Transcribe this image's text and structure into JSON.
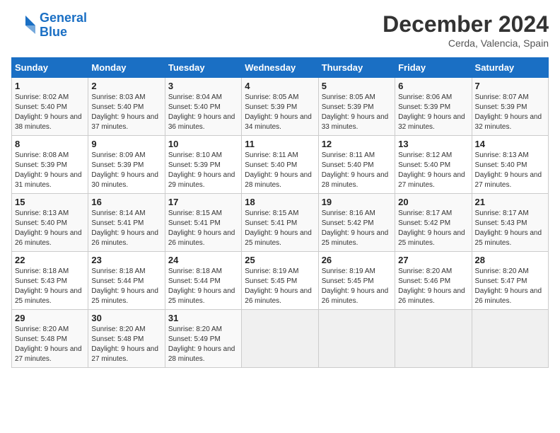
{
  "header": {
    "logo_line1": "General",
    "logo_line2": "Blue",
    "month": "December 2024",
    "location": "Cerda, Valencia, Spain"
  },
  "weekdays": [
    "Sunday",
    "Monday",
    "Tuesday",
    "Wednesday",
    "Thursday",
    "Friday",
    "Saturday"
  ],
  "weeks": [
    [
      {
        "day": "1",
        "info": "Sunrise: 8:02 AM\nSunset: 5:40 PM\nDaylight: 9 hours and 38 minutes."
      },
      {
        "day": "2",
        "info": "Sunrise: 8:03 AM\nSunset: 5:40 PM\nDaylight: 9 hours and 37 minutes."
      },
      {
        "day": "3",
        "info": "Sunrise: 8:04 AM\nSunset: 5:40 PM\nDaylight: 9 hours and 36 minutes."
      },
      {
        "day": "4",
        "info": "Sunrise: 8:05 AM\nSunset: 5:39 PM\nDaylight: 9 hours and 34 minutes."
      },
      {
        "day": "5",
        "info": "Sunrise: 8:05 AM\nSunset: 5:39 PM\nDaylight: 9 hours and 33 minutes."
      },
      {
        "day": "6",
        "info": "Sunrise: 8:06 AM\nSunset: 5:39 PM\nDaylight: 9 hours and 32 minutes."
      },
      {
        "day": "7",
        "info": "Sunrise: 8:07 AM\nSunset: 5:39 PM\nDaylight: 9 hours and 32 minutes."
      }
    ],
    [
      {
        "day": "8",
        "info": "Sunrise: 8:08 AM\nSunset: 5:39 PM\nDaylight: 9 hours and 31 minutes."
      },
      {
        "day": "9",
        "info": "Sunrise: 8:09 AM\nSunset: 5:39 PM\nDaylight: 9 hours and 30 minutes."
      },
      {
        "day": "10",
        "info": "Sunrise: 8:10 AM\nSunset: 5:39 PM\nDaylight: 9 hours and 29 minutes."
      },
      {
        "day": "11",
        "info": "Sunrise: 8:11 AM\nSunset: 5:40 PM\nDaylight: 9 hours and 28 minutes."
      },
      {
        "day": "12",
        "info": "Sunrise: 8:11 AM\nSunset: 5:40 PM\nDaylight: 9 hours and 28 minutes."
      },
      {
        "day": "13",
        "info": "Sunrise: 8:12 AM\nSunset: 5:40 PM\nDaylight: 9 hours and 27 minutes."
      },
      {
        "day": "14",
        "info": "Sunrise: 8:13 AM\nSunset: 5:40 PM\nDaylight: 9 hours and 27 minutes."
      }
    ],
    [
      {
        "day": "15",
        "info": "Sunrise: 8:13 AM\nSunset: 5:40 PM\nDaylight: 9 hours and 26 minutes."
      },
      {
        "day": "16",
        "info": "Sunrise: 8:14 AM\nSunset: 5:41 PM\nDaylight: 9 hours and 26 minutes."
      },
      {
        "day": "17",
        "info": "Sunrise: 8:15 AM\nSunset: 5:41 PM\nDaylight: 9 hours and 26 minutes."
      },
      {
        "day": "18",
        "info": "Sunrise: 8:15 AM\nSunset: 5:41 PM\nDaylight: 9 hours and 25 minutes."
      },
      {
        "day": "19",
        "info": "Sunrise: 8:16 AM\nSunset: 5:42 PM\nDaylight: 9 hours and 25 minutes."
      },
      {
        "day": "20",
        "info": "Sunrise: 8:17 AM\nSunset: 5:42 PM\nDaylight: 9 hours and 25 minutes."
      },
      {
        "day": "21",
        "info": "Sunrise: 8:17 AM\nSunset: 5:43 PM\nDaylight: 9 hours and 25 minutes."
      }
    ],
    [
      {
        "day": "22",
        "info": "Sunrise: 8:18 AM\nSunset: 5:43 PM\nDaylight: 9 hours and 25 minutes."
      },
      {
        "day": "23",
        "info": "Sunrise: 8:18 AM\nSunset: 5:44 PM\nDaylight: 9 hours and 25 minutes."
      },
      {
        "day": "24",
        "info": "Sunrise: 8:18 AM\nSunset: 5:44 PM\nDaylight: 9 hours and 25 minutes."
      },
      {
        "day": "25",
        "info": "Sunrise: 8:19 AM\nSunset: 5:45 PM\nDaylight: 9 hours and 26 minutes."
      },
      {
        "day": "26",
        "info": "Sunrise: 8:19 AM\nSunset: 5:45 PM\nDaylight: 9 hours and 26 minutes."
      },
      {
        "day": "27",
        "info": "Sunrise: 8:20 AM\nSunset: 5:46 PM\nDaylight: 9 hours and 26 minutes."
      },
      {
        "day": "28",
        "info": "Sunrise: 8:20 AM\nSunset: 5:47 PM\nDaylight: 9 hours and 26 minutes."
      }
    ],
    [
      {
        "day": "29",
        "info": "Sunrise: 8:20 AM\nSunset: 5:48 PM\nDaylight: 9 hours and 27 minutes."
      },
      {
        "day": "30",
        "info": "Sunrise: 8:20 AM\nSunset: 5:48 PM\nDaylight: 9 hours and 27 minutes."
      },
      {
        "day": "31",
        "info": "Sunrise: 8:20 AM\nSunset: 5:49 PM\nDaylight: 9 hours and 28 minutes."
      },
      null,
      null,
      null,
      null
    ]
  ]
}
